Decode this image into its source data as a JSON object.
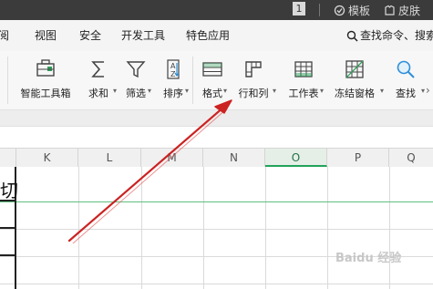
{
  "topbar": {
    "badge": "1",
    "template_label": "模板",
    "skin_label": "皮肤"
  },
  "menu": {
    "items": [
      "阅",
      "视图",
      "安全",
      "开发工具",
      "特色应用"
    ],
    "search_label": "查找命令、搜索"
  },
  "ribbon": {
    "tools": [
      {
        "label": "智能工具箱",
        "icon": "toolbox-icon"
      },
      {
        "label": "求和",
        "icon": "sum-icon",
        "dropdown": true
      },
      {
        "label": "筛选",
        "icon": "filter-icon",
        "dropdown": true
      },
      {
        "label": "排序",
        "icon": "sort-az-icon",
        "dropdown": true
      },
      {
        "label": "格式",
        "icon": "format-icon",
        "dropdown": true
      },
      {
        "label": "行和列",
        "icon": "rows-columns-icon",
        "dropdown": true
      },
      {
        "label": "工作表",
        "icon": "worksheet-icon",
        "dropdown": true
      },
      {
        "label": "冻结窗格",
        "icon": "freeze-panes-icon",
        "dropdown": true
      },
      {
        "label": "查找",
        "icon": "find-icon",
        "dropdown": true
      }
    ]
  },
  "sheet": {
    "columns": [
      "K",
      "L",
      "M",
      "N",
      "O",
      "P",
      "Q"
    ],
    "active_column": "O",
    "cell_fragment": "切"
  },
  "watermark": "Baidu 经验",
  "colors": {
    "accent_green": "#22a35a",
    "arrow_red": "#cc2222"
  }
}
